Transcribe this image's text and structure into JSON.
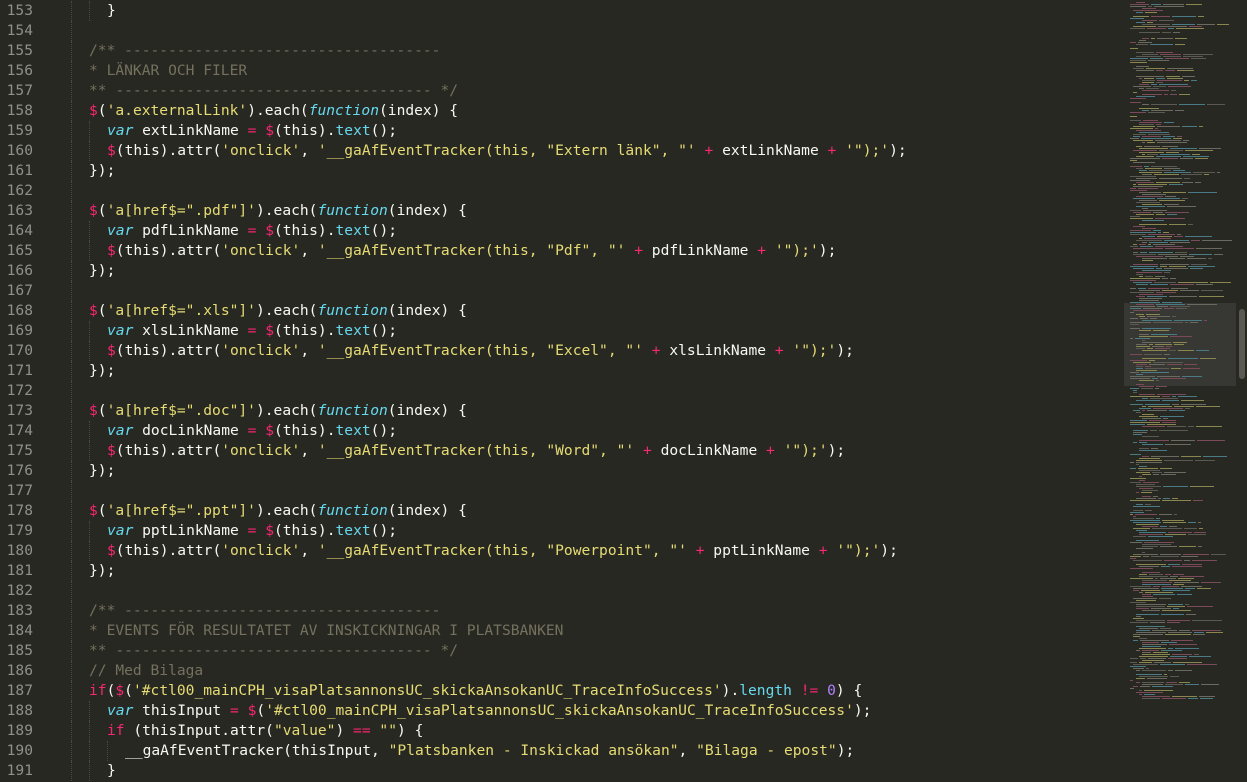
{
  "editor": {
    "lines": [
      {
        "n": "153",
        "i": 1,
        "t": [
          [
            "}",
            ""
          ]
        ]
      },
      {
        "n": "154",
        "i": 0,
        "t": []
      },
      {
        "n": "155",
        "i": 0,
        "t": [
          [
            "/** ------------------------------------",
            "c"
          ]
        ]
      },
      {
        "n": "156",
        "i": 0,
        "t": [
          [
            "* LÄNKAR OCH FILER",
            "c"
          ]
        ]
      },
      {
        "n": "157",
        "i": 0,
        "t": [
          [
            "** ------------------------------------ */",
            "c"
          ]
        ]
      },
      {
        "n": "158",
        "i": 0,
        "t": [
          [
            "$",
            "k"
          ],
          [
            "(",
            ""
          ],
          [
            "'a.externalLink'",
            "s"
          ],
          [
            ").each(",
            ""
          ],
          [
            "function",
            "f"
          ],
          [
            "(index) {",
            ""
          ]
        ]
      },
      {
        "n": "159",
        "i": 1,
        "t": [
          [
            "var",
            "f"
          ],
          [
            " extLinkName ",
            ""
          ],
          [
            "=",
            "k"
          ],
          [
            " ",
            ""
          ],
          [
            "$",
            "k"
          ],
          [
            "(this).",
            ""
          ],
          [
            "text",
            "b"
          ],
          [
            "();",
            ""
          ]
        ]
      },
      {
        "n": "160",
        "i": 1,
        "t": [
          [
            "$",
            "k"
          ],
          [
            "(this).attr(",
            ""
          ],
          [
            "'onclick'",
            "s"
          ],
          [
            ", ",
            ""
          ],
          [
            "'__gaAfEventTracker(this, \"Extern länk\", \"'",
            "s"
          ],
          [
            " ",
            ""
          ],
          [
            "+",
            "k"
          ],
          [
            " extLinkName ",
            ""
          ],
          [
            "+",
            "k"
          ],
          [
            " ",
            ""
          ],
          [
            "'\");'",
            "s"
          ],
          [
            ");",
            ""
          ]
        ]
      },
      {
        "n": "161",
        "i": 0,
        "t": [
          [
            "});",
            ""
          ]
        ]
      },
      {
        "n": "162",
        "i": 0,
        "t": []
      },
      {
        "n": "163",
        "i": 0,
        "t": [
          [
            "$",
            "k"
          ],
          [
            "(",
            ""
          ],
          [
            "'a[href$=\".pdf\"]'",
            "s"
          ],
          [
            ").each(",
            ""
          ],
          [
            "function",
            "f"
          ],
          [
            "(index) {",
            ""
          ]
        ]
      },
      {
        "n": "164",
        "i": 1,
        "t": [
          [
            "var",
            "f"
          ],
          [
            " pdfLinkName ",
            ""
          ],
          [
            "=",
            "k"
          ],
          [
            " ",
            ""
          ],
          [
            "$",
            "k"
          ],
          [
            "(this).",
            ""
          ],
          [
            "text",
            "b"
          ],
          [
            "();",
            ""
          ]
        ]
      },
      {
        "n": "165",
        "i": 1,
        "t": [
          [
            "$",
            "k"
          ],
          [
            "(this).attr(",
            ""
          ],
          [
            "'onclick'",
            "s"
          ],
          [
            ", ",
            ""
          ],
          [
            "'__gaAfEventTracker(this, \"Pdf\", \"'",
            "s"
          ],
          [
            " ",
            ""
          ],
          [
            "+",
            "k"
          ],
          [
            " pdfLinkName ",
            ""
          ],
          [
            "+",
            "k"
          ],
          [
            " ",
            ""
          ],
          [
            "'\");'",
            "s"
          ],
          [
            ");",
            ""
          ]
        ]
      },
      {
        "n": "166",
        "i": 0,
        "t": [
          [
            "});",
            ""
          ]
        ]
      },
      {
        "n": "167",
        "i": 0,
        "t": []
      },
      {
        "n": "168",
        "i": 0,
        "t": [
          [
            "$",
            "k"
          ],
          [
            "(",
            ""
          ],
          [
            "'a[href$=\".xls\"]'",
            "s"
          ],
          [
            ").each(",
            ""
          ],
          [
            "function",
            "f"
          ],
          [
            "(index) {",
            ""
          ]
        ]
      },
      {
        "n": "169",
        "i": 1,
        "t": [
          [
            "var",
            "f"
          ],
          [
            " xlsLinkName ",
            ""
          ],
          [
            "=",
            "k"
          ],
          [
            " ",
            ""
          ],
          [
            "$",
            "k"
          ],
          [
            "(this).",
            ""
          ],
          [
            "text",
            "b"
          ],
          [
            "();",
            ""
          ]
        ]
      },
      {
        "n": "170",
        "i": 1,
        "t": [
          [
            "$",
            "k"
          ],
          [
            "(this).attr(",
            ""
          ],
          [
            "'onclick'",
            "s"
          ],
          [
            ", ",
            ""
          ],
          [
            "'__gaAfEventTracker(this, \"Excel\", \"'",
            "s"
          ],
          [
            " ",
            ""
          ],
          [
            "+",
            "k"
          ],
          [
            " xlsLinkName ",
            ""
          ],
          [
            "+",
            "k"
          ],
          [
            " ",
            ""
          ],
          [
            "'\");'",
            "s"
          ],
          [
            ");",
            ""
          ]
        ]
      },
      {
        "n": "171",
        "i": 0,
        "t": [
          [
            "});",
            ""
          ]
        ]
      },
      {
        "n": "172",
        "i": 0,
        "t": []
      },
      {
        "n": "173",
        "i": 0,
        "t": [
          [
            "$",
            "k"
          ],
          [
            "(",
            ""
          ],
          [
            "'a[href$=\".doc\"]'",
            "s"
          ],
          [
            ").each(",
            ""
          ],
          [
            "function",
            "f"
          ],
          [
            "(index) {",
            ""
          ]
        ]
      },
      {
        "n": "174",
        "i": 1,
        "t": [
          [
            "var",
            "f"
          ],
          [
            " docLinkName ",
            ""
          ],
          [
            "=",
            "k"
          ],
          [
            " ",
            ""
          ],
          [
            "$",
            "k"
          ],
          [
            "(this).",
            ""
          ],
          [
            "text",
            "b"
          ],
          [
            "();",
            ""
          ]
        ]
      },
      {
        "n": "175",
        "i": 1,
        "t": [
          [
            "$",
            "k"
          ],
          [
            "(this).attr(",
            ""
          ],
          [
            "'onclick'",
            "s"
          ],
          [
            ", ",
            ""
          ],
          [
            "'__gaAfEventTracker(this, \"Word\", \"'",
            "s"
          ],
          [
            " ",
            ""
          ],
          [
            "+",
            "k"
          ],
          [
            " docLinkName ",
            ""
          ],
          [
            "+",
            "k"
          ],
          [
            " ",
            ""
          ],
          [
            "'\");'",
            "s"
          ],
          [
            ");",
            ""
          ]
        ]
      },
      {
        "n": "176",
        "i": 0,
        "t": [
          [
            "});",
            ""
          ]
        ]
      },
      {
        "n": "177",
        "i": 0,
        "t": []
      },
      {
        "n": "178",
        "i": 0,
        "t": [
          [
            "$",
            "k"
          ],
          [
            "(",
            ""
          ],
          [
            "'a[href$=\".ppt\"]'",
            "s"
          ],
          [
            ").each(",
            ""
          ],
          [
            "function",
            "f"
          ],
          [
            "(index) {",
            ""
          ]
        ]
      },
      {
        "n": "179",
        "i": 1,
        "t": [
          [
            "var",
            "f"
          ],
          [
            " pptLinkName ",
            ""
          ],
          [
            "=",
            "k"
          ],
          [
            " ",
            ""
          ],
          [
            "$",
            "k"
          ],
          [
            "(this).",
            ""
          ],
          [
            "text",
            "b"
          ],
          [
            "();",
            ""
          ]
        ]
      },
      {
        "n": "180",
        "i": 1,
        "t": [
          [
            "$",
            "k"
          ],
          [
            "(this).attr(",
            ""
          ],
          [
            "'onclick'",
            "s"
          ],
          [
            ", ",
            ""
          ],
          [
            "'__gaAfEventTracker(this, \"Powerpoint\", \"'",
            "s"
          ],
          [
            " ",
            ""
          ],
          [
            "+",
            "k"
          ],
          [
            " pptLinkName ",
            ""
          ],
          [
            "+",
            "k"
          ],
          [
            " ",
            ""
          ],
          [
            "'\");'",
            "s"
          ],
          [
            ");",
            ""
          ]
        ]
      },
      {
        "n": "181",
        "i": 0,
        "t": [
          [
            "});",
            ""
          ]
        ]
      },
      {
        "n": "182",
        "i": 0,
        "t": []
      },
      {
        "n": "183",
        "i": 0,
        "t": [
          [
            "/** ------------------------------------",
            "c"
          ]
        ]
      },
      {
        "n": "184",
        "i": 0,
        "t": [
          [
            "* EVENTS FÖR RESULTATET AV INSKICKNINGAR I PLATSBANKEN",
            "c"
          ]
        ]
      },
      {
        "n": "185",
        "i": 0,
        "t": [
          [
            "** ------------------------------------ */",
            "c"
          ]
        ]
      },
      {
        "n": "186",
        "i": 0,
        "t": [
          [
            "// Med Bilaga",
            "c"
          ]
        ]
      },
      {
        "n": "187",
        "i": 0,
        "t": [
          [
            "if",
            "k"
          ],
          [
            "(",
            ""
          ],
          [
            "$",
            "k"
          ],
          [
            "(",
            ""
          ],
          [
            "'#ctl00_mainCPH_visaPlatsannonsUC_skickaAnsokanUC_TraceInfoSuccess'",
            "s"
          ],
          [
            ").",
            ""
          ],
          [
            "length",
            "b"
          ],
          [
            " ",
            ""
          ],
          [
            "!=",
            "k"
          ],
          [
            " ",
            ""
          ],
          [
            "0",
            "n"
          ],
          [
            ") {",
            ""
          ]
        ]
      },
      {
        "n": "188",
        "i": 1,
        "t": [
          [
            "var",
            "f"
          ],
          [
            " thisInput ",
            ""
          ],
          [
            "=",
            "k"
          ],
          [
            " ",
            ""
          ],
          [
            "$",
            "k"
          ],
          [
            "(",
            ""
          ],
          [
            "'#ctl00_mainCPH_visaPlatsannonsUC_skickaAnsokanUC_TraceInfoSuccess'",
            "s"
          ],
          [
            ");",
            ""
          ]
        ]
      },
      {
        "n": "189",
        "i": 1,
        "t": [
          [
            "if",
            "k"
          ],
          [
            " (thisInput.attr(",
            ""
          ],
          [
            "\"value\"",
            "s"
          ],
          [
            ") ",
            ""
          ],
          [
            "==",
            "k"
          ],
          [
            " ",
            ""
          ],
          [
            "\"\"",
            "s"
          ],
          [
            ") {",
            ""
          ]
        ]
      },
      {
        "n": "190",
        "i": 2,
        "t": [
          [
            "__gaAfEventTracker(thisInput, ",
            ""
          ],
          [
            "\"Platsbanken - Inskickad ansökan\"",
            "s"
          ],
          [
            ", ",
            ""
          ],
          [
            "\"Bilaga - epost\"",
            "s"
          ],
          [
            ");",
            ""
          ]
        ]
      },
      {
        "n": "191",
        "i": 1,
        "t": [
          [
            "}",
            ""
          ]
        ]
      }
    ]
  },
  "colors": {
    "background": "#272822",
    "keyword": "#f92672",
    "string": "#e6db74",
    "function": "#66d9ef",
    "number": "#ae81ff",
    "comment": "#75715e",
    "text": "#f8f8f2",
    "line_number": "#90908a"
  }
}
